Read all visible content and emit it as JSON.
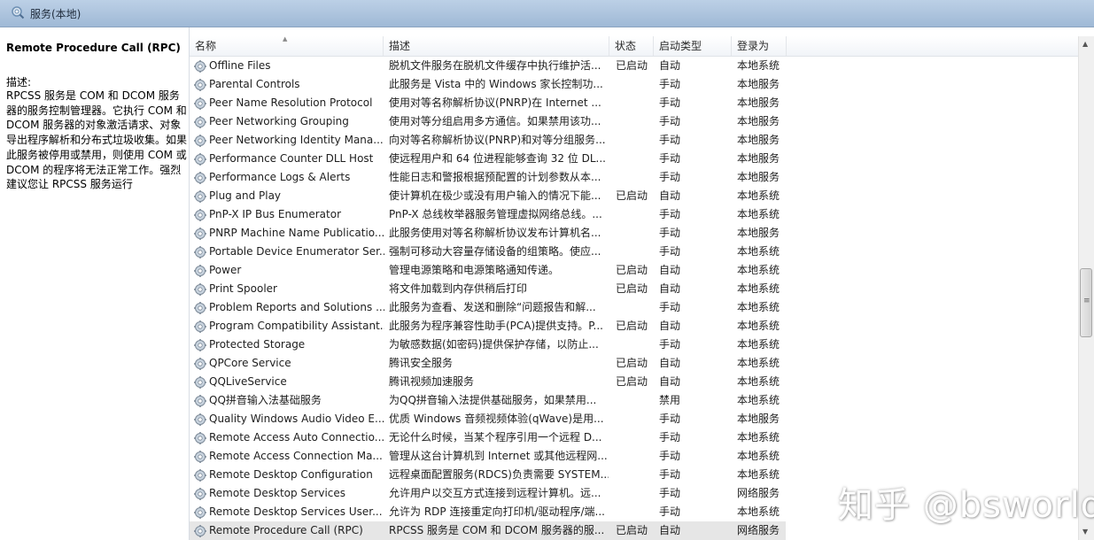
{
  "window": {
    "title": "服务(本地)",
    "icon": "gear-magnifier-icon"
  },
  "details": {
    "service_name": "Remote Procedure Call (RPC)",
    "description_label": "描述:",
    "description": "RPCSS 服务是 COM 和 DCOM 服务器的服务控制管理器。它执行 COM 和 DCOM 服务器的对象激活请求、对象导出程序解析和分布式垃圾收集。如果此服务被停用或禁用，则使用 COM 或 DCOM 的程序将无法正常工作。强烈建议您让 RPCSS 服务运行"
  },
  "columns": {
    "name": "名称",
    "description": "描述",
    "status": "状态",
    "startup": "启动类型",
    "logon": "登录为"
  },
  "services": [
    {
      "name": "Offline Files",
      "description": "脱机文件服务在脱机文件缓存中执行维护活...",
      "status": "已启动",
      "startup": "自动",
      "logon": "本地系统"
    },
    {
      "name": "Parental Controls",
      "description": "此服务是 Vista 中的 Windows 家长控制功...",
      "status": "",
      "startup": "手动",
      "logon": "本地服务"
    },
    {
      "name": "Peer Name Resolution Protocol",
      "description": "使用对等名称解析协议(PNRP)在 Internet ...",
      "status": "",
      "startup": "手动",
      "logon": "本地服务"
    },
    {
      "name": "Peer Networking Grouping",
      "description": "使用对等分组启用多方通信。如果禁用该功...",
      "status": "",
      "startup": "手动",
      "logon": "本地服务"
    },
    {
      "name": "Peer Networking Identity Mana...",
      "description": "向对等名称解析协议(PNRP)和对等分组服务...",
      "status": "",
      "startup": "手动",
      "logon": "本地服务"
    },
    {
      "name": "Performance Counter DLL Host",
      "description": "使远程用户和 64 位进程能够查询 32 位 DL...",
      "status": "",
      "startup": "手动",
      "logon": "本地服务"
    },
    {
      "name": "Performance Logs & Alerts",
      "description": "性能日志和警报根据预配置的计划参数从本...",
      "status": "",
      "startup": "手动",
      "logon": "本地服务"
    },
    {
      "name": "Plug and Play",
      "description": "使计算机在极少或没有用户输入的情况下能...",
      "status": "已启动",
      "startup": "自动",
      "logon": "本地系统"
    },
    {
      "name": "PnP-X IP Bus Enumerator",
      "description": "PnP-X 总线枚举器服务管理虚拟网络总线。...",
      "status": "",
      "startup": "手动",
      "logon": "本地系统"
    },
    {
      "name": "PNRP Machine Name Publicatio...",
      "description": "此服务使用对等名称解析协议发布计算机名...",
      "status": "",
      "startup": "手动",
      "logon": "本地服务"
    },
    {
      "name": "Portable Device Enumerator Ser...",
      "description": "强制可移动大容量存储设备的组策略。使应...",
      "status": "",
      "startup": "手动",
      "logon": "本地系统"
    },
    {
      "name": "Power",
      "description": "管理电源策略和电源策略通知传递。",
      "status": "已启动",
      "startup": "自动",
      "logon": "本地系统"
    },
    {
      "name": "Print Spooler",
      "description": "将文件加载到内存供稍后打印",
      "status": "已启动",
      "startup": "自动",
      "logon": "本地系统"
    },
    {
      "name": "Problem Reports and Solutions ...",
      "description": "此服务为查看、发送和删除“问题报告和解...",
      "status": "",
      "startup": "手动",
      "logon": "本地系统"
    },
    {
      "name": "Program Compatibility Assistant...",
      "description": "此服务为程序兼容性助手(PCA)提供支持。P...",
      "status": "已启动",
      "startup": "自动",
      "logon": "本地系统"
    },
    {
      "name": "Protected Storage",
      "description": "为敏感数据(如密码)提供保护存储，以防止...",
      "status": "",
      "startup": "手动",
      "logon": "本地系统"
    },
    {
      "name": "QPCore Service",
      "description": "腾讯安全服务",
      "status": "已启动",
      "startup": "自动",
      "logon": "本地系统"
    },
    {
      "name": "QQLiveService",
      "description": "腾讯视频加速服务",
      "status": "已启动",
      "startup": "自动",
      "logon": "本地系统"
    },
    {
      "name": "QQ拼音输入法基础服务",
      "description": "为QQ拼音输入法提供基础服务，如果禁用...",
      "status": "",
      "startup": "禁用",
      "logon": "本地系统"
    },
    {
      "name": "Quality Windows Audio Video E...",
      "description": "优质 Windows 音频视频体验(qWave)是用...",
      "status": "",
      "startup": "手动",
      "logon": "本地服务"
    },
    {
      "name": "Remote Access Auto Connectio...",
      "description": "无论什么时候，当某个程序引用一个远程 D...",
      "status": "",
      "startup": "手动",
      "logon": "本地系统"
    },
    {
      "name": "Remote Access Connection Ma...",
      "description": "管理从这台计算机到 Internet 或其他远程网...",
      "status": "",
      "startup": "手动",
      "logon": "本地系统"
    },
    {
      "name": "Remote Desktop Configuration",
      "description": "远程桌面配置服务(RDCS)负责需要 SYSTEM...",
      "status": "",
      "startup": "手动",
      "logon": "本地系统"
    },
    {
      "name": "Remote Desktop Services",
      "description": "允许用户以交互方式连接到远程计算机。远...",
      "status": "",
      "startup": "手动",
      "logon": "网络服务"
    },
    {
      "name": "Remote Desktop Services User...",
      "description": "允许为 RDP 连接重定向打印机/驱动程序/端...",
      "status": "",
      "startup": "手动",
      "logon": "本地系统"
    },
    {
      "name": "Remote Procedure Call (RPC)",
      "description": "RPCSS 服务是 COM 和 DCOM 服务器的服...",
      "status": "已启动",
      "startup": "自动",
      "logon": "网络服务",
      "selected": true
    }
  ],
  "watermark": "知乎 @bsworld"
}
